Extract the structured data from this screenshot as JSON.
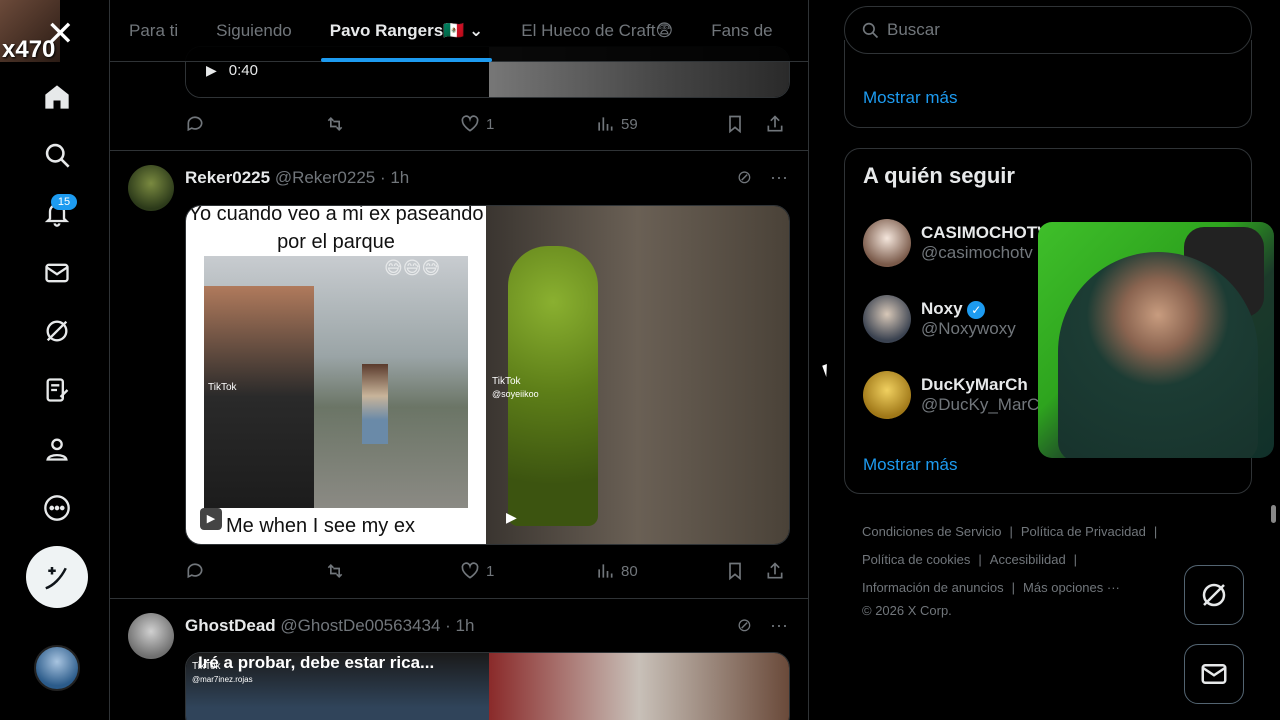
{
  "overlay": {
    "text": "x470"
  },
  "nav": {
    "notifications_count": "15",
    "icons": [
      "home-icon",
      "search-icon",
      "bell-icon",
      "mail-icon",
      "grok-icon",
      "lists-icon",
      "profile-icon",
      "more-icon"
    ]
  },
  "tabs": [
    {
      "label": "Para ti",
      "active": false
    },
    {
      "label": "Siguiendo",
      "active": false
    },
    {
      "label": "Pavo Rangers🇲🇽 ⌄",
      "active": true
    },
    {
      "label": "El Hueco de Craft😨",
      "active": false
    },
    {
      "label": "Fans de",
      "active": false
    }
  ],
  "tweets": [
    {
      "video_time": "0:40",
      "likes": "1",
      "views": "59"
    },
    {
      "name": "Reker0225",
      "handle": "@Reker0225 · 1h",
      "caption_top": "Yo cuando veo a mi ex paseando por el parque",
      "caption_emoji": "😅😅😅",
      "caption_bottom": "Me when I see my ex",
      "tiktok1": "TikTok",
      "tiktok2": "TikTok",
      "tiktok2_user": "@soyeiikoo",
      "likes": "1",
      "views": "80"
    },
    {
      "name": "GhostDead",
      "handle": "@GhostDe00563434 · 1h",
      "caption": "Iré a probar, debe estar rica...",
      "tiktok": "TikTok",
      "tiktok_user": "@mar7inez.rojas"
    }
  ],
  "right": {
    "search_placeholder": "Buscar",
    "show_more_1": "Mostrar más",
    "who_to_follow": "A quién seguir",
    "follow": [
      {
        "name": "CASIMOCHOTV",
        "handle": "@casimochotv"
      },
      {
        "name": "Noxy",
        "handle": "@Noxywoxy"
      },
      {
        "name": "DucKyMarCh",
        "handle": "@DucKy_MarCh"
      }
    ],
    "show_more_2": "Mostrar más",
    "footer": {
      "l1": "Condiciones de Servicio",
      "l2": "Política de Privacidad",
      "l3": "Política de cookies",
      "l4": "Accesibilidad",
      "l5": "Información de anuncios",
      "l6": "Más opciones ···",
      "copyright": "© 2026 X Corp."
    }
  },
  "colors": {
    "accent": "#1d9bf0",
    "bg": "#000000",
    "muted": "#71767b",
    "border": "#2f3336"
  }
}
